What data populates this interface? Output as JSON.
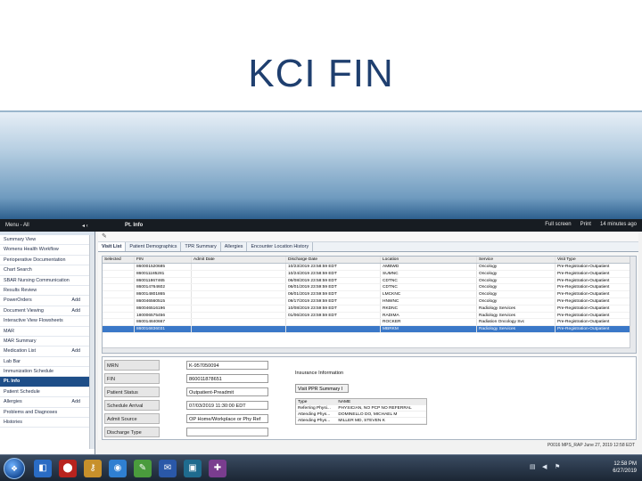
{
  "slide_title": "KCI FIN",
  "topbar": {
    "menu_label": "Menu - All",
    "menu_controls": "◂ ‹",
    "pt_info": "Pt. Info",
    "full_screen": "Full screen",
    "print": "Print",
    "refresh": "14 minutes ago"
  },
  "nav": {
    "items": [
      {
        "label": "Summary View",
        "add": ""
      },
      {
        "label": "Womens Health Workflow",
        "add": ""
      },
      {
        "label": "Perioperative Documentation",
        "add": ""
      },
      {
        "label": "Chart Search",
        "add": ""
      },
      {
        "label": "SBAR Nursing Communication",
        "add": ""
      },
      {
        "label": "Results Review",
        "add": ""
      },
      {
        "label": "PowerOrders",
        "add": "Add"
      },
      {
        "label": "Document Viewing",
        "add": "Add"
      },
      {
        "label": "Interactive View Flowsheets",
        "add": ""
      },
      {
        "label": "MAR",
        "add": ""
      },
      {
        "label": "MAR Summary",
        "add": ""
      },
      {
        "label": "Medication List",
        "add": "Add"
      },
      {
        "label": "Lab Bar",
        "add": ""
      },
      {
        "label": "Immunization Schedule",
        "add": ""
      },
      {
        "label": "Pt. Info",
        "add": ""
      },
      {
        "label": "Patient Schedule",
        "add": ""
      },
      {
        "label": "Allergies",
        "add": "Add"
      },
      {
        "label": "Problems and Diagnoses",
        "add": ""
      },
      {
        "label": "Histories",
        "add": ""
      }
    ]
  },
  "tabs": [
    "Visit List",
    "Patient Demographics",
    "TPR Summary",
    "Allergies",
    "Encounter Location History"
  ],
  "grid": {
    "columns": [
      "Selected",
      "FIN",
      "Admit Date",
      "Discharge Date",
      "Location",
      "Service",
      "Visit Type"
    ],
    "rows": [
      [
        "",
        "860001520685",
        "",
        "10/23/2019 23:58:59 EDT",
        "AMBWD",
        "Oncology",
        "Pre-Registration-Outpatient"
      ],
      [
        "",
        "860011185281",
        "",
        "10/24/2019 23:58:59 EDT",
        "SUMNC",
        "Oncology",
        "Pre-Registration-Outpatient"
      ],
      [
        "",
        "860011867465",
        "",
        "06/08/2019 23:58:59 EDT",
        "CDTNC",
        "Oncology",
        "Pre-Registration-Outpatient"
      ],
      [
        "",
        "860014764602",
        "",
        "06/01/2019 23:59:59 EDT",
        "CDTNC",
        "Oncology",
        "Pre-Registration-Outpatient"
      ],
      [
        "",
        "860014801865",
        "",
        "06/01/2019 23:59:59 EDT",
        "LMCKNC",
        "Oncology",
        "Pre-Registration-Outpatient"
      ],
      [
        "",
        "860046560515",
        "",
        "09/17/2019 23:59:59 EDT",
        "HNWNC",
        "Oncology",
        "Pre-Registration-Outpatient"
      ],
      [
        "",
        "860046516196",
        "",
        "10/08/2019 23:59:59 EDT",
        "RKDNC",
        "Radiology Services",
        "Pre-Registration-Outpatient"
      ],
      [
        "",
        "180006575456",
        "",
        "01/06/2019 23:59:59 EDT",
        "RADIMA",
        "Radiology Services",
        "Pre-Registration-Outpatient"
      ],
      [
        "",
        "860014840667",
        "",
        "",
        "ROCKER",
        "Radiation Oncology Svc",
        "Pre-Registration-Outpatient"
      ],
      [
        "",
        "860016836031",
        "",
        "",
        "MBRKM",
        "Radiology Services",
        "Pre-Registration-Outpatient"
      ]
    ],
    "selected_index": 9
  },
  "detail": {
    "fields": [
      {
        "label": "MRN",
        "value": "K-957050094"
      },
      {
        "label": "FIN",
        "value": "860011878651"
      },
      {
        "label": "Patient Status",
        "value": "Outpatient-Preadmit"
      },
      {
        "label": "Schedule Arrival",
        "value": "07/03/2019 11:30:00 EDT"
      },
      {
        "label": "Admit Source",
        "value": "OP Home/Workplace or Phy Ref"
      },
      {
        "label": "Discharge Type",
        "value": ""
      }
    ],
    "insurance_title": "Insurance Information",
    "summary_button": "Visit PPR Summary I",
    "phys_headers": [
      "Type",
      "NAME"
    ],
    "physicians": [
      [
        "Referring Physi...",
        "PHYSICIAN, NO PCP NO REFERRAL"
      ],
      [
        "Attending Phys...",
        "DOMINELLO DO, MICHAEL M"
      ],
      [
        "Attending Phys...",
        "MILLER MD, STEVEN K"
      ]
    ]
  },
  "statusbar": "P0016 MPS_RAP June 27, 2019 12:58 EDT",
  "taskbar": {
    "clock_time": "12:58 PM",
    "clock_date": "6/27/2019",
    "icons": [
      {
        "name": "windows-logo-icon",
        "color": "#2a6cc4"
      },
      {
        "name": "adobe-reader-icon",
        "color": "#b8231e"
      },
      {
        "name": "key-app-icon",
        "color": "#c7902b"
      },
      {
        "name": "browser-icon",
        "color": "#2f7fd1"
      },
      {
        "name": "paint-icon",
        "color": "#4a9b3d"
      },
      {
        "name": "outlook-icon",
        "color": "#2a58a8"
      },
      {
        "name": "publisher-icon",
        "color": "#1f6b8e"
      },
      {
        "name": "cerner-icon",
        "color": "#7a3d8f"
      }
    ]
  }
}
